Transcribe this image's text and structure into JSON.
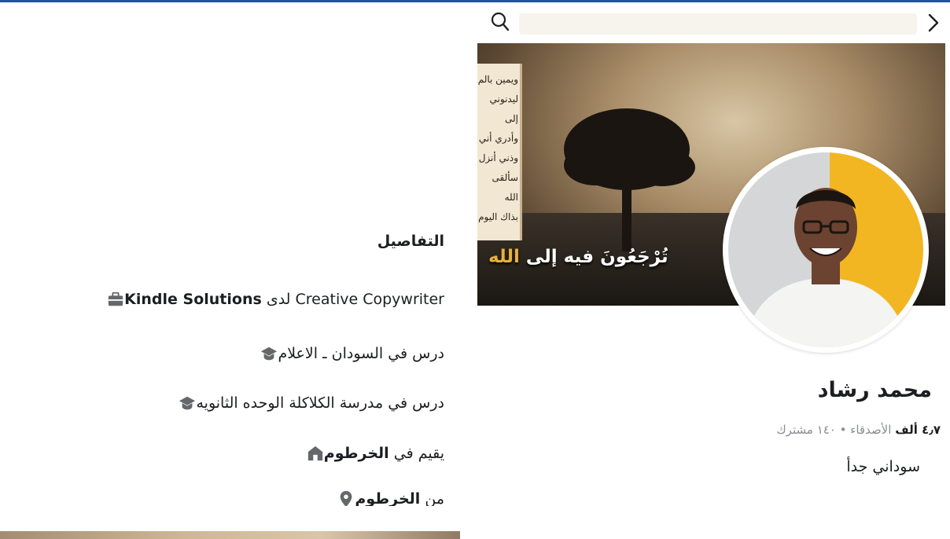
{
  "details": {
    "title": "التفاصيل",
    "work": {
      "role": "Creative Copywriter",
      "at": "لدى",
      "company": "Kindle Solutions"
    },
    "education_1": "درس في السودان ـ الاعلام",
    "education_2": "درس في مدرسة الكلاكلة الوحده الثانويه",
    "lives_prefix": "يقيم في",
    "lives_city": "الخرطوم",
    "from_prefix": "من",
    "from_city": "الخرطوم"
  },
  "cover": {
    "scroll_lines": [
      "ويمين بالم",
      "ليدنوني إلى",
      "وأدري أني",
      "وذني أنزل",
      "سألقى الله",
      "بذاك اليوم"
    ],
    "caption_main": "تُرْجَعُونَ فيه إلى",
    "caption_accent": "الله"
  },
  "profile": {
    "name": "محمد رشاد",
    "friends_count": "٤٫٧ ألف",
    "friends_label": "الأصدقاء",
    "separator": "•",
    "followers_count": "١٤٠",
    "followers_label": "مشترك",
    "bio": "سوداني جدأ"
  },
  "icons": {
    "work": "briefcase-icon",
    "education": "graduation-cap-icon",
    "home": "home-icon",
    "location": "location-pin-icon",
    "search": "search-icon",
    "chevron": "chevron-right-icon"
  },
  "colors": {
    "top_rule": "#1e53a6",
    "icon_gray": "#65676b",
    "avatar_bg": "#f2b622"
  }
}
